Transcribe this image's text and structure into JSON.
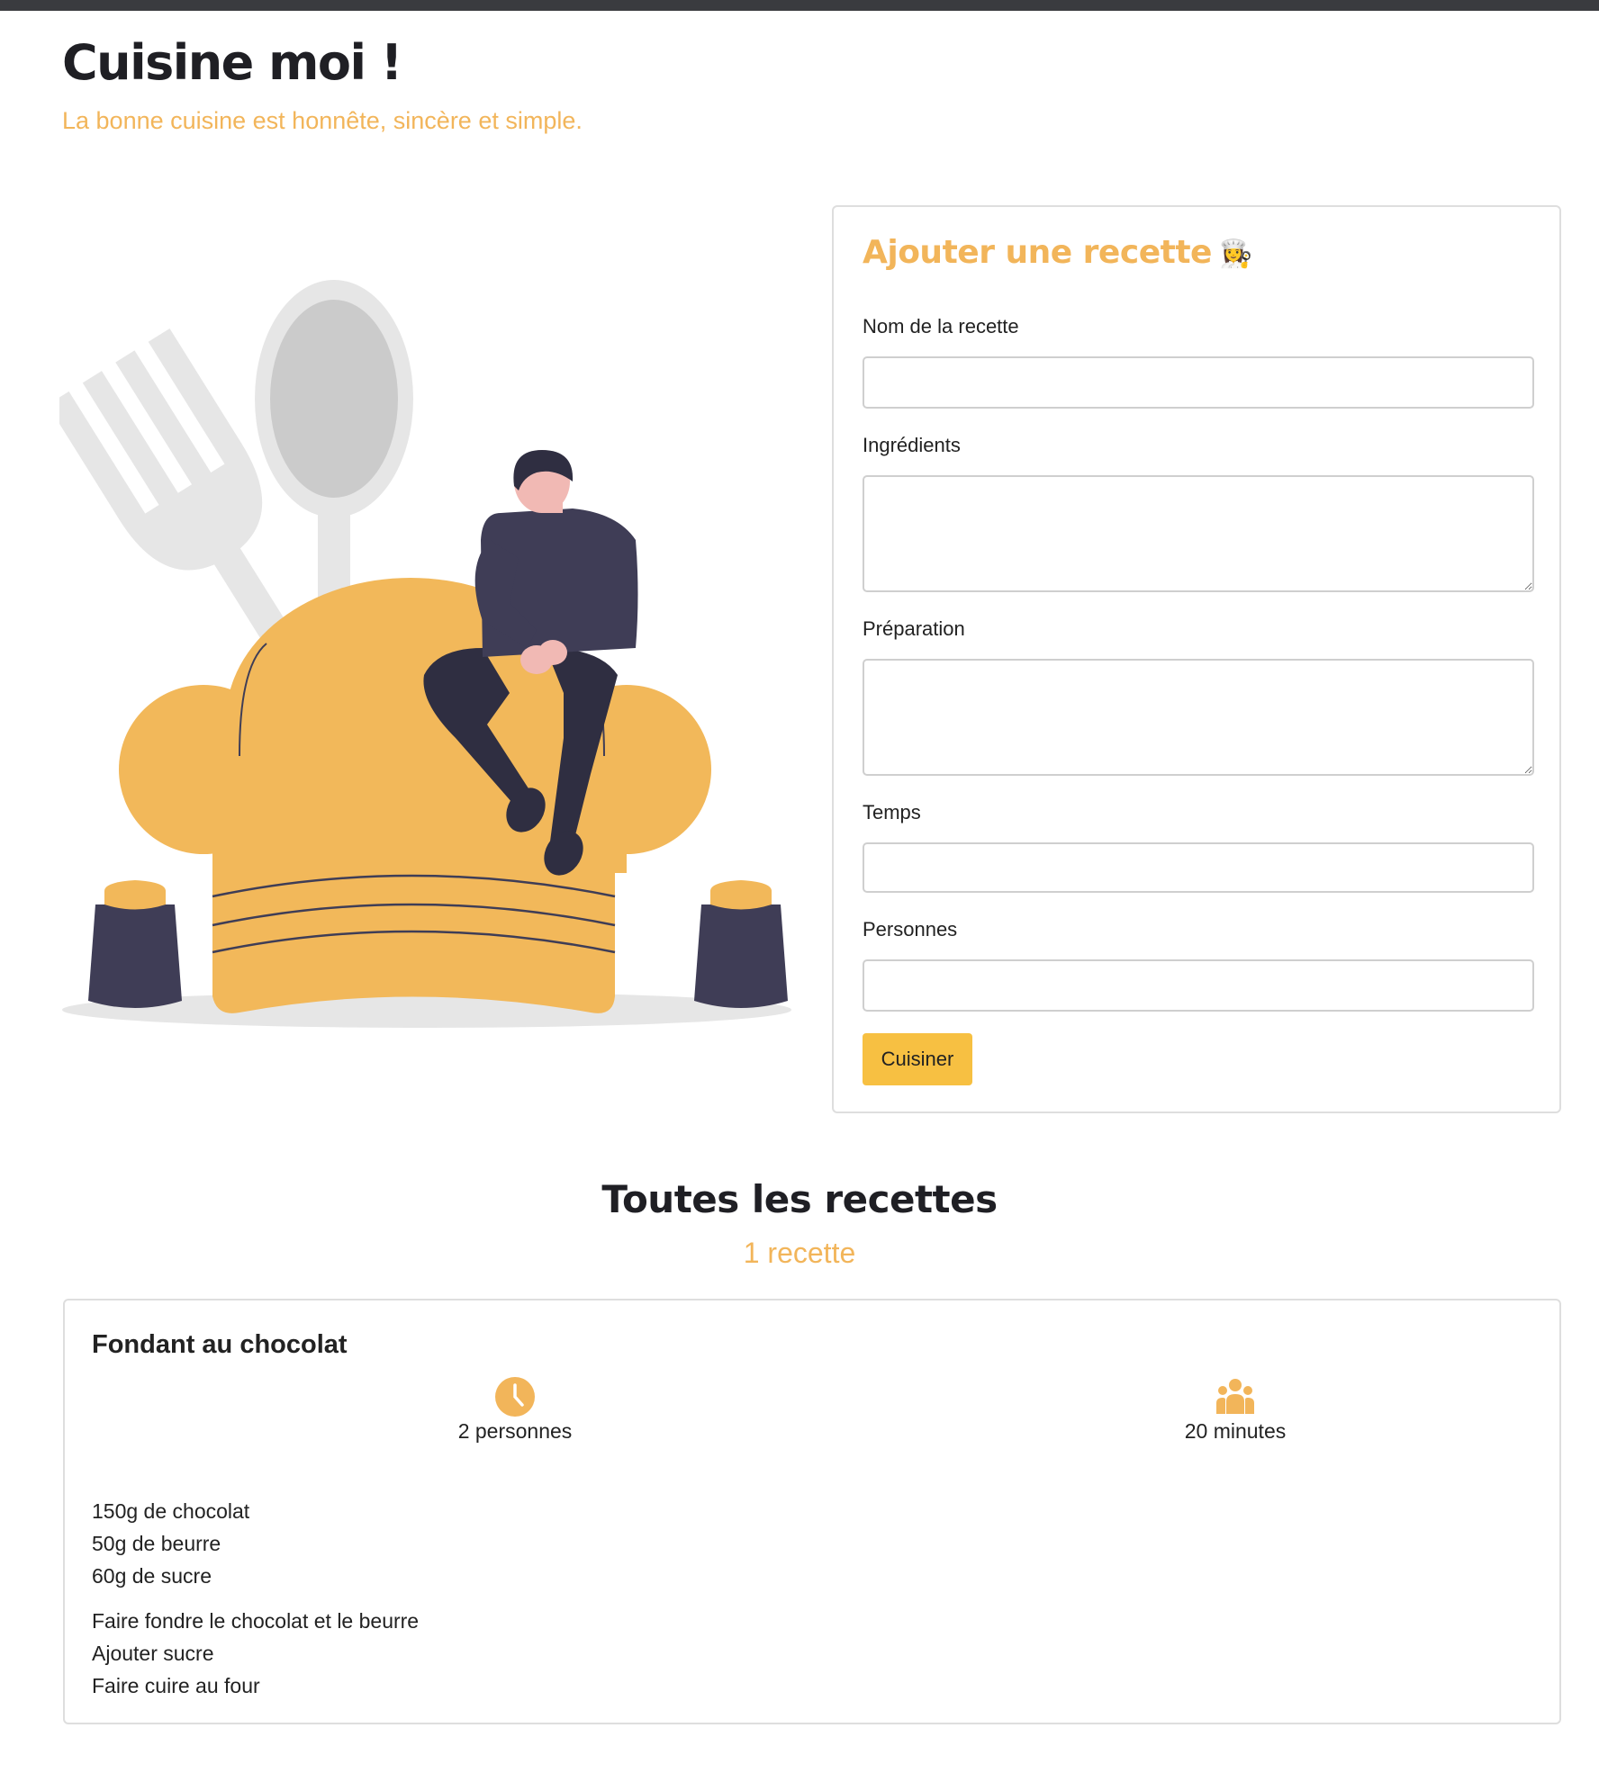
{
  "header": {
    "title": "Cuisine moi !",
    "subtitle": "La bonne cuisine est honnête, sincère et simple."
  },
  "form": {
    "title": "Ajouter une recette",
    "title_emoji": "👩‍🍳",
    "name_label": "Nom de la recette",
    "name_value": "",
    "ingredients_label": "Ingrédients",
    "ingredients_value": "",
    "preparation_label": "Préparation",
    "preparation_value": "",
    "time_label": "Temps",
    "time_value": "",
    "people_label": "Personnes",
    "people_value": "",
    "submit_label": "Cuisiner"
  },
  "recipes_section": {
    "title": "Toutes les recettes",
    "count": "1 recette"
  },
  "recipes": [
    {
      "name": "Fondant au chocolat",
      "people": "2 personnes",
      "time": "20 minutes",
      "ingredients": [
        "150g de chocolat",
        "50g de beurre",
        "60g de sucre"
      ],
      "steps": [
        "Faire fondre le chocolat et le beurre",
        "Ajouter sucre",
        "Faire cuire au four"
      ]
    }
  ],
  "colors": {
    "accent": "#f2b55a",
    "button": "#f7c042",
    "dark": "#3f3d56",
    "text": "#222222"
  },
  "icons": {
    "clock": "clock-icon",
    "people": "users-icon"
  }
}
